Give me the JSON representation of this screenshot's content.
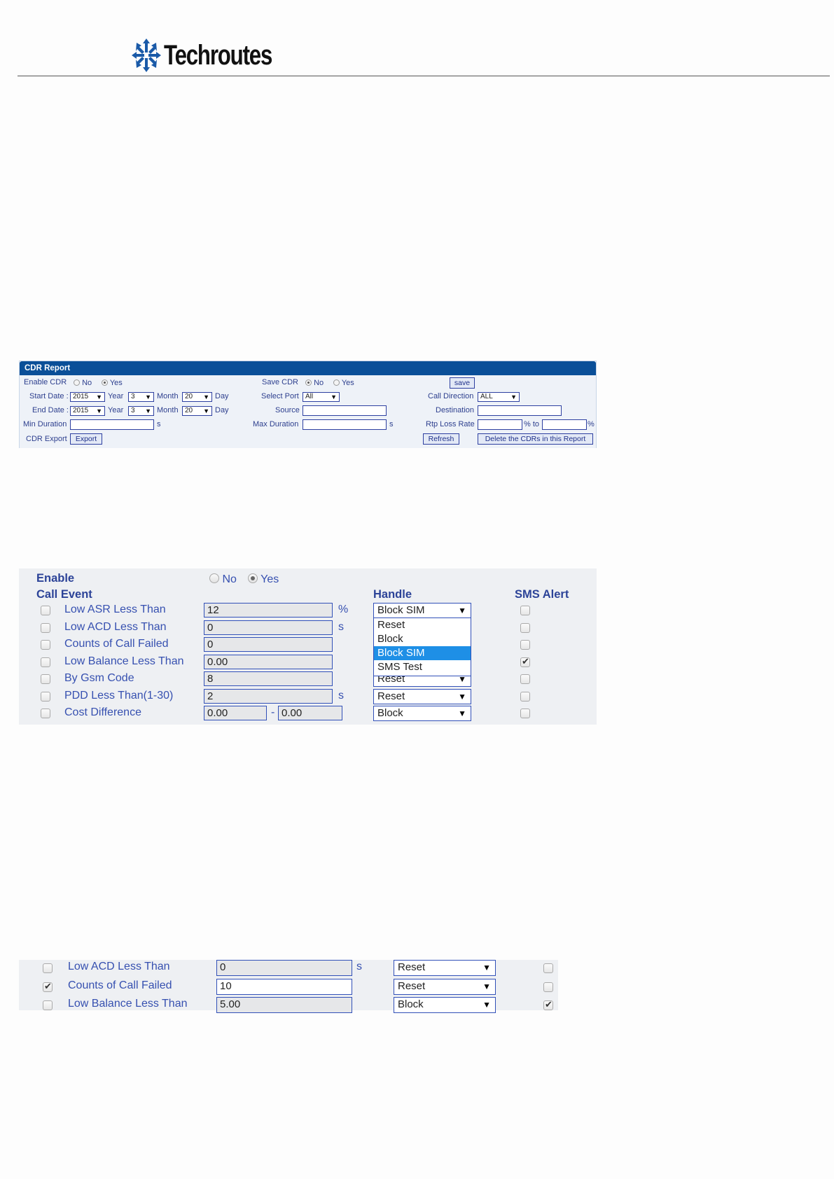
{
  "header": {
    "brand": "Techroutes"
  },
  "cdr": {
    "title": "CDR Report",
    "enable_cdr": {
      "label": "Enable CDR",
      "no": "No",
      "yes": "Yes",
      "selected": "Yes"
    },
    "save_cdr": {
      "label": "Save CDR",
      "no": "No",
      "yes": "Yes",
      "selected": "No"
    },
    "save_button": "save",
    "start_date": {
      "label": "Start Date :",
      "year": "2015",
      "year_label": "Year",
      "month": "3",
      "month_label": "Month",
      "day": "20",
      "day_label": "Day"
    },
    "end_date": {
      "label": "End Date :",
      "year": "2015",
      "year_label": "Year",
      "month": "3",
      "month_label": "Month",
      "day": "20",
      "day_label": "Day"
    },
    "select_port": {
      "label": "Select Port",
      "value": "All"
    },
    "call_direction": {
      "label": "Call Direction",
      "value": "ALL"
    },
    "source_label": "Source",
    "destination_label": "Destination",
    "min_duration": {
      "label": "Min Duration",
      "unit": "s"
    },
    "max_duration": {
      "label": "Max Duration",
      "unit": "s"
    },
    "rtp_loss": {
      "label": "Rtp Loss Rate",
      "mid": "% to",
      "unit": "%"
    },
    "cdr_export_label": "CDR Export",
    "export_button": "Export",
    "refresh_button": "Refresh",
    "delete_button": "Delete the CDRs in this Report"
  },
  "events": {
    "enable_label": "Enable",
    "no": "No",
    "yes": "Yes",
    "selected": "Yes",
    "col_event": "Call Event",
    "col_handle": "Handle",
    "col_sms": "SMS Alert",
    "rows": [
      {
        "label": "Low ASR Less Than",
        "value": "12",
        "unit": "%",
        "handle": "Block SIM",
        "checked": false,
        "sms": false
      },
      {
        "label": "Low ACD Less Than",
        "value": "0",
        "unit": "s",
        "handle": "",
        "checked": false,
        "sms": false
      },
      {
        "label": "Counts of Call Failed",
        "value": "0",
        "unit": "",
        "handle": "",
        "checked": false,
        "sms": false
      },
      {
        "label": "Low Balance Less Than",
        "value": "0.00",
        "unit": "",
        "handle": "",
        "checked": false,
        "sms": true
      },
      {
        "label": "By Gsm Code",
        "value": "8",
        "unit": "",
        "handle": "Reset",
        "checked": false,
        "sms": false
      },
      {
        "label": "PDD Less Than(1-30)",
        "value": "2",
        "unit": "s",
        "handle": "Reset",
        "checked": false,
        "sms": false
      },
      {
        "label": "Cost Difference",
        "value": "0.00",
        "value2": "0.00",
        "sep": "-",
        "unit": "",
        "handle": "Block",
        "checked": false,
        "sms": false
      }
    ],
    "dropdown_options": [
      "Reset",
      "Block",
      "Block SIM",
      "SMS Test"
    ],
    "dropdown_highlight": "Block SIM"
  },
  "events2": {
    "rows": [
      {
        "label": "Low ACD Less Than",
        "value": "0",
        "unit": "s",
        "handle": "Reset",
        "checked": false,
        "sms": false
      },
      {
        "label": "Counts of Call Failed",
        "value": "10",
        "unit": "",
        "handle": "Reset",
        "checked": true,
        "sms": false
      },
      {
        "label": "Low Balance Less Than",
        "value": "5.00",
        "unit": "",
        "handle": "Block",
        "checked": false,
        "sms": true
      }
    ]
  },
  "colors": {
    "cdr_header": "#0a4f98",
    "highlight": "#1e8fe6",
    "label_blue": "#3650b0"
  }
}
